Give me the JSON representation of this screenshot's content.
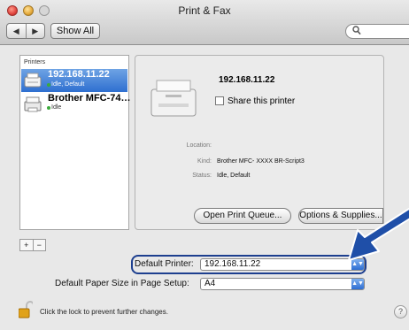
{
  "window": {
    "title": "Print & Fax"
  },
  "toolbar": {
    "back_glyph": "◀",
    "forward_glyph": "▶",
    "show_all_label": "Show All",
    "search_icon": "search-icon",
    "search_placeholder": ""
  },
  "printers_list": {
    "header": "Printers",
    "items": [
      {
        "name": "192.168.11.22",
        "status": "Idle, Default",
        "selected": true
      },
      {
        "name": "Brother MFC-74…",
        "status": "Idle",
        "selected": false
      }
    ]
  },
  "details": {
    "printer_name": "192.168.11.22",
    "share_label": "Share this printer",
    "share_checked": false,
    "location_label": "Location:",
    "location_value": "",
    "kind_label": "Kind:",
    "kind_value": "Brother MFC- XXXX BR-Script3",
    "status_label": "Status:",
    "status_value": "Idle, Default",
    "open_queue_label": "Open Print Queue...",
    "options_label": "Options & Supplies..."
  },
  "list_controls": {
    "add_label": "+",
    "remove_label": "−"
  },
  "defaults": {
    "default_printer_label": "Default Printer:",
    "default_printer_value": "192.168.11.22",
    "paper_size_label": "Default Paper Size in Page Setup:",
    "paper_size_value": "A4"
  },
  "footer": {
    "lock_text": "Click the lock to prevent further changes.",
    "help_label": "?"
  },
  "colors": {
    "selection": "#3b7ad9",
    "highlight_ring": "#1d3f8f",
    "arrow": "#1f4fa8"
  }
}
